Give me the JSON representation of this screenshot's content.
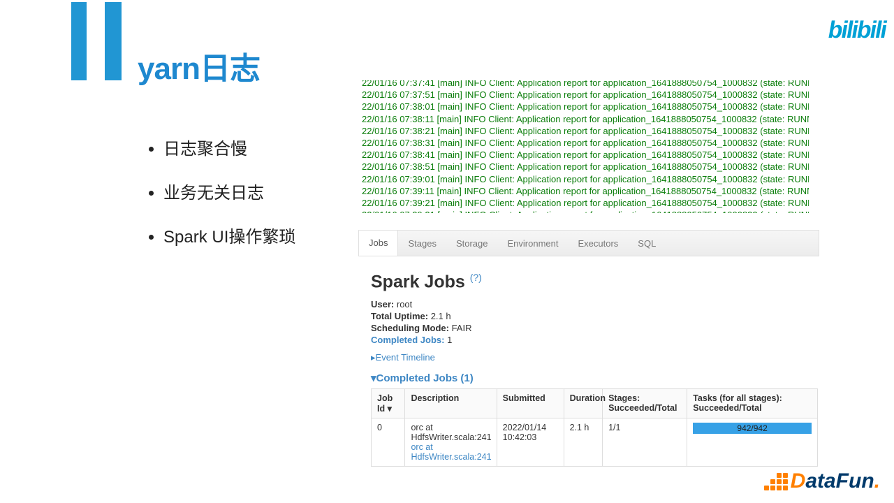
{
  "title": "yarn日志",
  "bullets": [
    "日志聚合慢",
    "业务无关日志",
    "Spark UI操作繁琐"
  ],
  "log_prefix_times": [
    "07:37:41",
    "07:37:51",
    "07:38:01",
    "07:38:11",
    "07:38:21",
    "07:38:31",
    "07:38:41",
    "07:38:51",
    "07:39:01",
    "07:39:11",
    "07:39:21"
  ],
  "log_template_a": "22/01/16 ",
  "log_template_b": " [main] INFO Client: Application report for application_1641888050754_1000832 (state: RUNNING)",
  "spark": {
    "tabs": [
      "Jobs",
      "Stages",
      "Storage",
      "Environment",
      "Executors",
      "SQL"
    ],
    "heading": "Spark Jobs ",
    "qmark": "(?)",
    "user_label": "User:",
    "user_value": " root",
    "uptime_label": "Total Uptime:",
    "uptime_value": " 2.1 h",
    "sched_label": "Scheduling Mode:",
    "sched_value": " FAIR",
    "completed_label": "Completed Jobs:",
    "completed_value": " 1",
    "event_timeline": "Event Timeline",
    "completed_header": "Completed Jobs (1)",
    "cols": {
      "jobid": "Job Id ▾",
      "desc": "Description",
      "submitted": "Submitted",
      "duration": "Duration",
      "stages": "Stages: Succeeded/Total",
      "tasks": "Tasks (for all stages): Succeeded/Total"
    },
    "row": {
      "id": "0",
      "desc1": "orc at HdfsWriter.scala:241",
      "desc2": "orc at HdfsWriter.scala:241",
      "submitted": "2022/01/14 10:42:03",
      "duration": "2.1 h",
      "stages": "1/1",
      "tasks": "942/942"
    }
  },
  "branding": {
    "bilibili": "bilibili",
    "datafun_d": "D",
    "datafun_rest": "ataFun",
    "datafun_period": "."
  }
}
